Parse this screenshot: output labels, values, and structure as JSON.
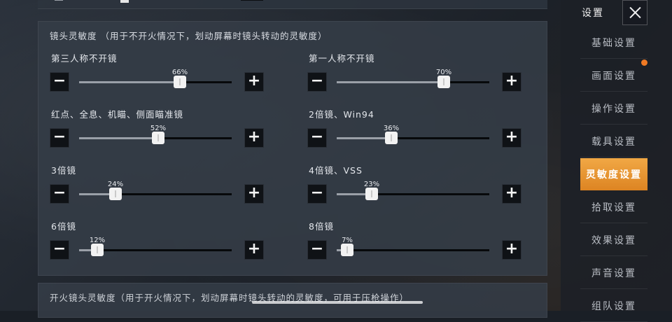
{
  "panel": {
    "title": "镜头灵敏度 （用于不开火情况下，划动屏幕时镜头转动的灵敏度）",
    "sliders": [
      {
        "label": "第三人称不开镜",
        "value": 66,
        "percent": "66%",
        "col": 0,
        "row": 0
      },
      {
        "label": "第一人称不开镜",
        "value": 70,
        "percent": "70%",
        "col": 1,
        "row": 0
      },
      {
        "label": "红点、全息、机瞄、侧面瞄准镜",
        "value": 52,
        "percent": "52%",
        "col": 0,
        "row": 1
      },
      {
        "label": "2倍镜、Win94",
        "value": 36,
        "percent": "36%",
        "col": 1,
        "row": 1
      },
      {
        "label": "3倍镜",
        "value": 24,
        "percent": "24%",
        "col": 0,
        "row": 2
      },
      {
        "label": "4倍镜、VSS",
        "value": 23,
        "percent": "23%",
        "col": 1,
        "row": 2
      },
      {
        "label": "6倍镜",
        "value": 12,
        "percent": "12%",
        "col": 0,
        "row": 3
      },
      {
        "label": "8倍镜",
        "value": 7,
        "percent": "7%",
        "col": 1,
        "row": 3
      }
    ],
    "minus_label": "−",
    "plus_label": "+"
  },
  "panel2": {
    "title": "开火镜头灵敏度（用于开火情况下，划动屏幕时镜头转动的灵敏度，可用于压枪操作）"
  },
  "menu": {
    "title": "设置",
    "items": [
      {
        "label": "基础设置",
        "active": false
      },
      {
        "label": "画面设置",
        "active": false
      },
      {
        "label": "操作设置",
        "active": false
      },
      {
        "label": "载具设置",
        "active": false
      },
      {
        "label": "灵敏度设置",
        "active": true
      },
      {
        "label": "拾取设置",
        "active": false
      },
      {
        "label": "效果设置",
        "active": false
      },
      {
        "label": "声音设置",
        "active": false
      },
      {
        "label": "组队设置",
        "active": false
      }
    ]
  },
  "colors": {
    "accent": "#e8952f",
    "notification_dot": "#f07a24"
  },
  "icons": {
    "close": "close-icon",
    "minus": "minus-icon",
    "plus": "plus-icon"
  }
}
